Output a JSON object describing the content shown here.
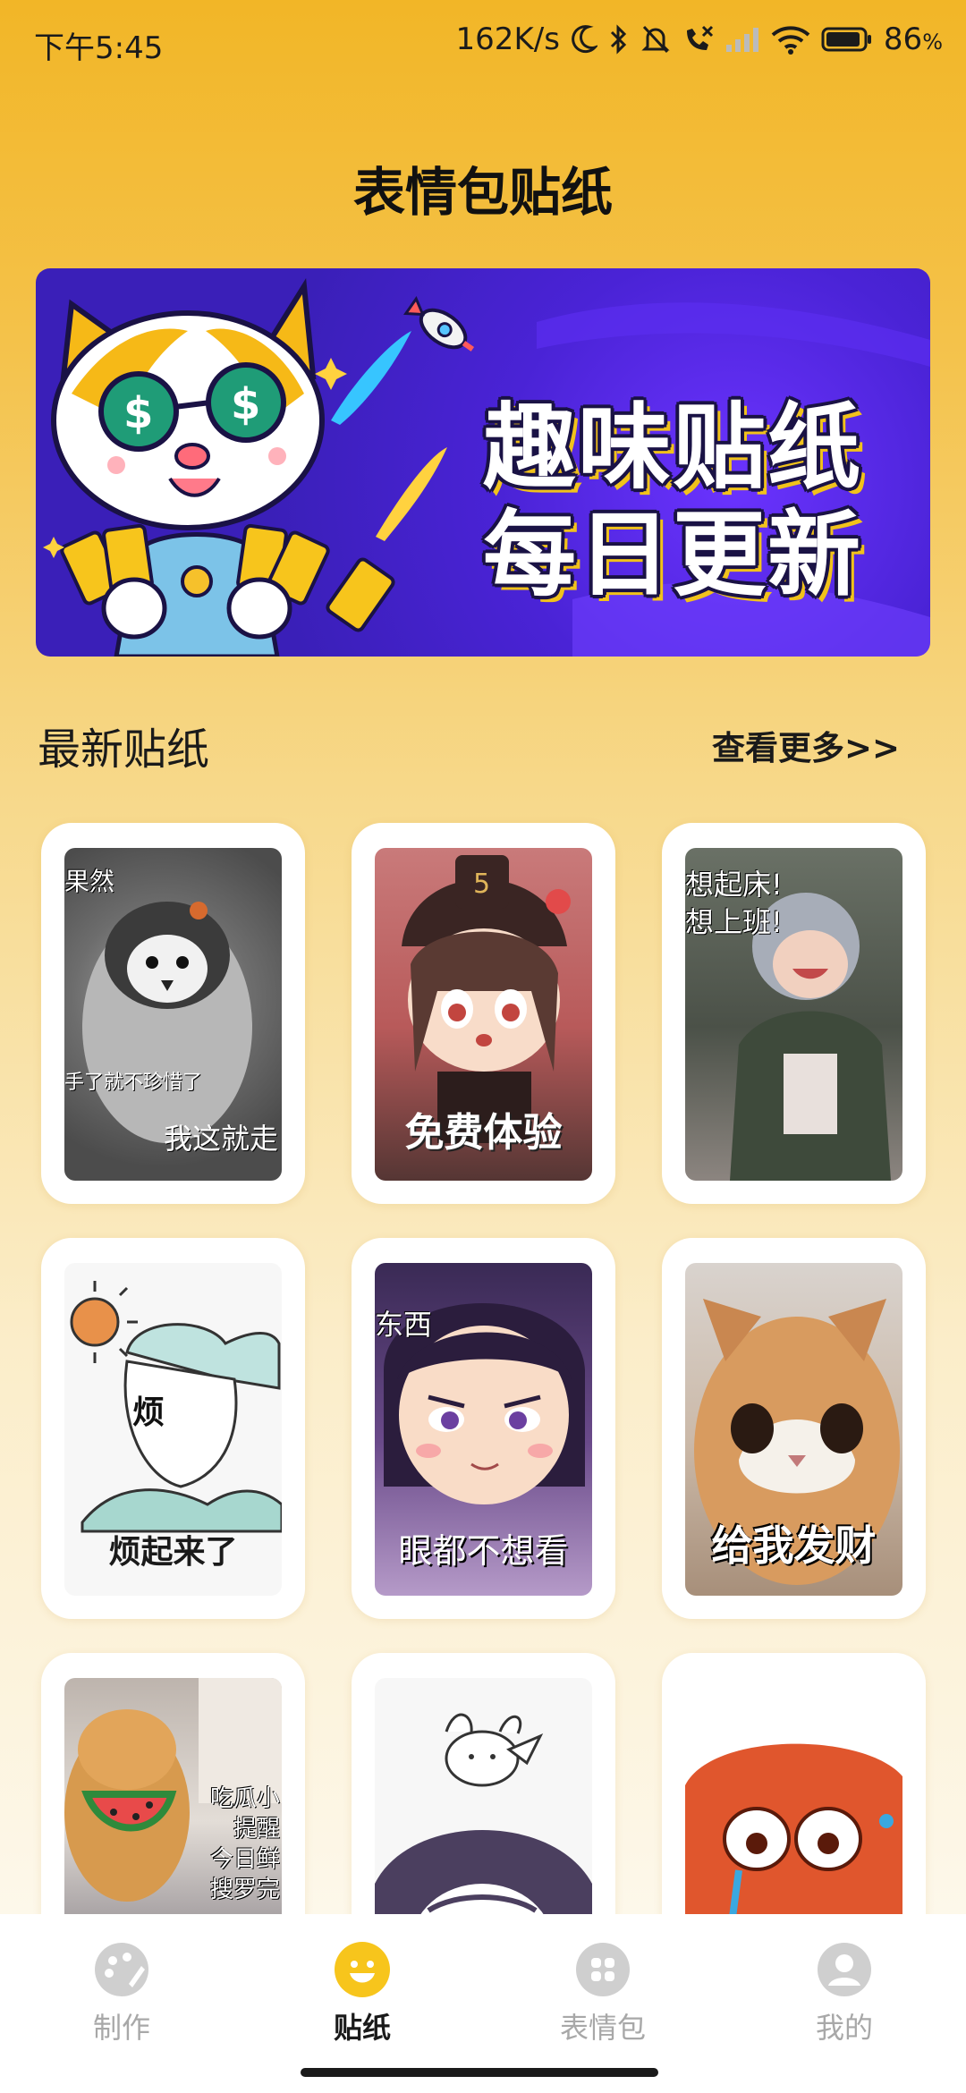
{
  "status_bar": {
    "time": "下午5:45",
    "network_speed": "162K/s",
    "battery": "86",
    "battery_unit": "%"
  },
  "page": {
    "title": "表情包贴纸"
  },
  "banner": {
    "line1": "趣味贴纸",
    "line2": "每日更新"
  },
  "section": {
    "title": "最新贴纸",
    "more": "查看更多>>"
  },
  "stickers": [
    {
      "top": "果然",
      "mid": "手了就不珍惜了",
      "caption": "我这就走"
    },
    {
      "caption": "免费体验"
    },
    {
      "top": "想起床!",
      "top2": "想上班!"
    },
    {
      "mid": "烦",
      "caption": "烦起来了"
    },
    {
      "top": "东西",
      "caption": "眼都不想看"
    },
    {
      "caption": "给我发财"
    },
    {
      "side1": "吃瓜小",
      "side2": "提醒",
      "side3": "今日鲜",
      "side4": "搜罗完"
    },
    {},
    {}
  ],
  "nav": {
    "items": [
      {
        "label": "制作",
        "icon": "palette-icon"
      },
      {
        "label": "贴纸",
        "icon": "smiley-icon"
      },
      {
        "label": "表情包",
        "icon": "grid-icon"
      },
      {
        "label": "我的",
        "icon": "person-icon"
      }
    ],
    "active_index": 1
  },
  "colors": {
    "background_top": "#f2b627",
    "background_bottom": "#fefcf5",
    "banner_bg": "#4a23d6",
    "active_nav": "#f7c51c",
    "inactive_nav": "#cfcfcf"
  }
}
